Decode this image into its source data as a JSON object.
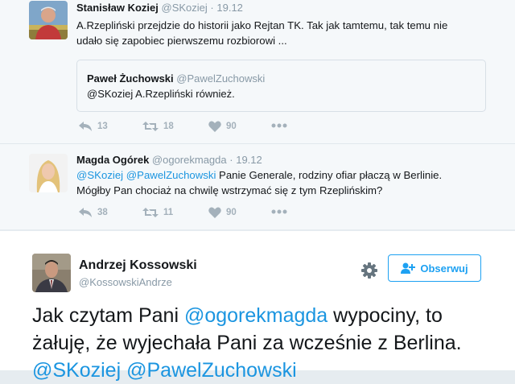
{
  "thread": {
    "tweet1": {
      "name": "Stanisław Koziej",
      "handle": "@SKoziej",
      "dot": "·",
      "time": "19.12",
      "text_line1": "A.Rzepliński przejdzie do historii jako Rejtan TK. Tak jak tamtemu, tak temu nie",
      "text_line2": "udało się zapobiec pierwszemu rozbiorowi ...",
      "quote": {
        "name": "Paweł Żuchowski",
        "handle": "@PawelZuchowski",
        "text": "@SKoziej A.Rzepliński również."
      },
      "reply_count": "13",
      "retweet_count": "18",
      "like_count": "90"
    },
    "tweet2": {
      "name": "Magda Ogórek",
      "handle": "@ogorekmagda",
      "dot": "·",
      "time": "19.12",
      "mention1": "@SKoziej",
      "mention2": "@PawelZuchowski",
      "text_rest1": " Panie Generale, rodziny ofiar płaczą w Berlinie.",
      "text_line2": "Mógłby Pan chociaż na chwilę wstrzymać się z tym Rzeplińskim?",
      "reply_count": "38",
      "retweet_count": "11",
      "like_count": "90"
    }
  },
  "main": {
    "name": "Andrzej Kossowski",
    "handle": "@KossowskiAndrze",
    "follow_label": "Obserwuj",
    "text_part1": "Jak czytam Pani ",
    "mention_ogorek": "@ogorekmagda",
    "text_part2": " wypociny, to żałuję, że wyjechała Pani za wcześnie z Berlina. ",
    "mention_koziej": "@SKoziej",
    "mention_zuchowski": "@PawelZuchowski"
  },
  "colors": {
    "link": "#1b95e0",
    "icon_gray": "#a4b1bb",
    "follow_blue": "#1da1f2"
  },
  "icons": [
    "reply-icon",
    "retweet-icon",
    "heart-icon",
    "more-icon",
    "gear-icon",
    "add-user-icon"
  ]
}
